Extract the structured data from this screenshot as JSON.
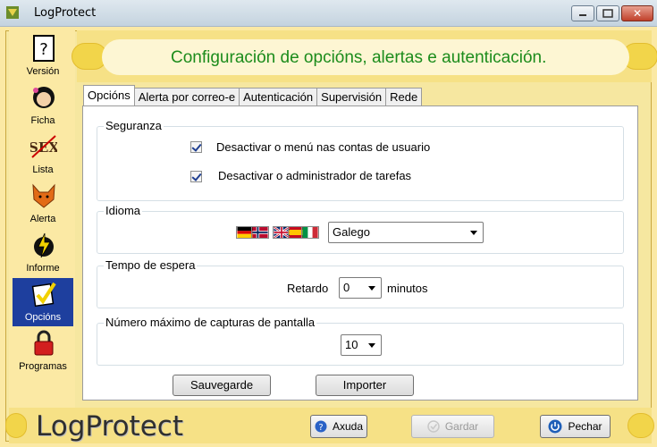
{
  "window": {
    "title": "LogProtect",
    "close_glyph": "✕"
  },
  "colors": {
    "accent": "#1c8c1c",
    "frame": "#f6e186",
    "active_nav": "#1e3f9e"
  },
  "sidebar": {
    "items": [
      {
        "label": "Versión",
        "icon": "help-book-icon"
      },
      {
        "label": "Ficha",
        "icon": "girl-avatar-icon"
      },
      {
        "label": "Lista",
        "icon": "sex-list-icon"
      },
      {
        "label": "Alerta",
        "icon": "fox-alert-icon"
      },
      {
        "label": "Informe",
        "icon": "lightning-report-icon"
      },
      {
        "label": "Opcións",
        "icon": "checkmark-options-icon"
      },
      {
        "label": "Programas",
        "icon": "padlock-icon"
      }
    ],
    "active": "Opcións"
  },
  "header": {
    "title": "Configuración de opcións, alertas e autenticación."
  },
  "tabs": [
    "Opcións",
    "Alerta por correo-e",
    "Autenticación",
    "Supervisión",
    "Rede"
  ],
  "seguranza": {
    "label": "Seguranza",
    "options": [
      {
        "label": "Desactivar o menú nas contas de usuario",
        "checked": true
      },
      {
        "label": "Desactivar o administrador de tarefas",
        "checked": true
      }
    ]
  },
  "idioma": {
    "label": "Idioma",
    "selected": "Galego"
  },
  "tempo": {
    "label": "Tempo de espera",
    "retardo_label": "Retardo",
    "value": "0",
    "unit": "minutos"
  },
  "capturas": {
    "label": "Número máximo de capturas de pantalla",
    "value": "10"
  },
  "actions": {
    "save": "Sauvegarde",
    "import": "Importer"
  },
  "footer": {
    "logo": "LogProtect",
    "help": "Axuda",
    "save": "Gardar",
    "close": "Pechar"
  }
}
